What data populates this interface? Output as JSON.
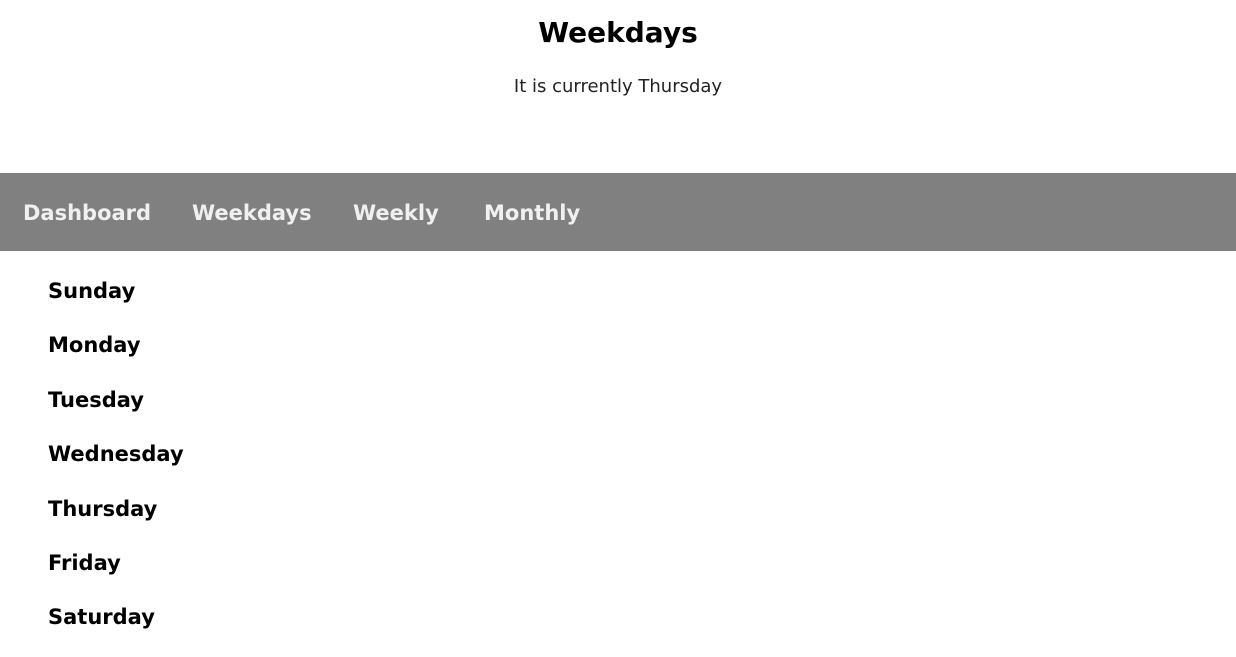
{
  "header": {
    "title": "Weekdays",
    "status": "It is currently Thursday"
  },
  "nav": {
    "items": [
      {
        "label": "Dashboard"
      },
      {
        "label": "Weekdays"
      },
      {
        "label": "Weekly"
      },
      {
        "label": "Monthly"
      }
    ]
  },
  "days": [
    {
      "label": "Sunday"
    },
    {
      "label": "Monday"
    },
    {
      "label": "Tuesday"
    },
    {
      "label": "Wednesday"
    },
    {
      "label": "Thursday"
    },
    {
      "label": "Friday"
    },
    {
      "label": "Saturday"
    }
  ],
  "colors": {
    "navbar_background": "#808080",
    "nav_text": "#f0f0f0",
    "page_background": "#ffffff"
  }
}
